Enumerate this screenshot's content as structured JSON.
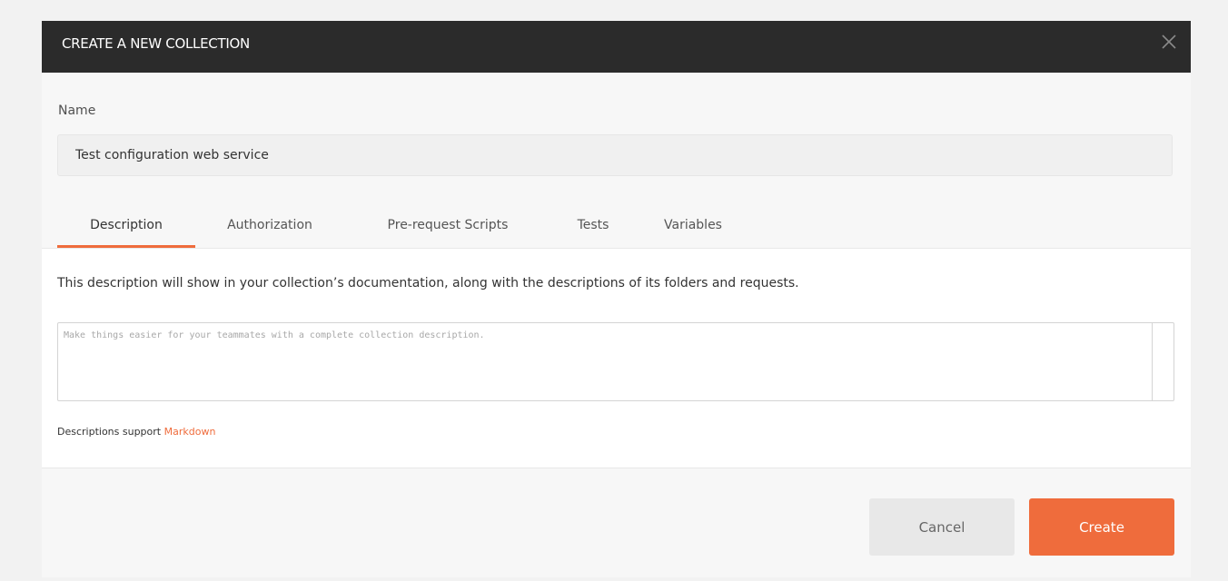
{
  "dialog": {
    "title": "CREATE A NEW COLLECTION",
    "close_icon": "close-icon"
  },
  "name_field": {
    "label": "Name",
    "value": "Test configuration web service"
  },
  "tabs": [
    {
      "label": "Description",
      "active": true
    },
    {
      "label": "Authorization",
      "active": false
    },
    {
      "label": "Pre-request Scripts",
      "active": false
    },
    {
      "label": "Tests",
      "active": false
    },
    {
      "label": "Variables",
      "active": false
    }
  ],
  "description": {
    "help_text": "This description will show in your collection’s documentation, along with the descriptions of its folders and requests.",
    "placeholder": "Make things easier for your teammates with a complete collection description.",
    "markdown_prefix": "Descriptions support ",
    "markdown_link": "Markdown"
  },
  "footer": {
    "cancel_label": "Cancel",
    "create_label": "Create"
  },
  "colors": {
    "accent": "#ef6c3c",
    "header_bg": "#2b2b2b",
    "cancel_bg": "#e8e8e8"
  }
}
